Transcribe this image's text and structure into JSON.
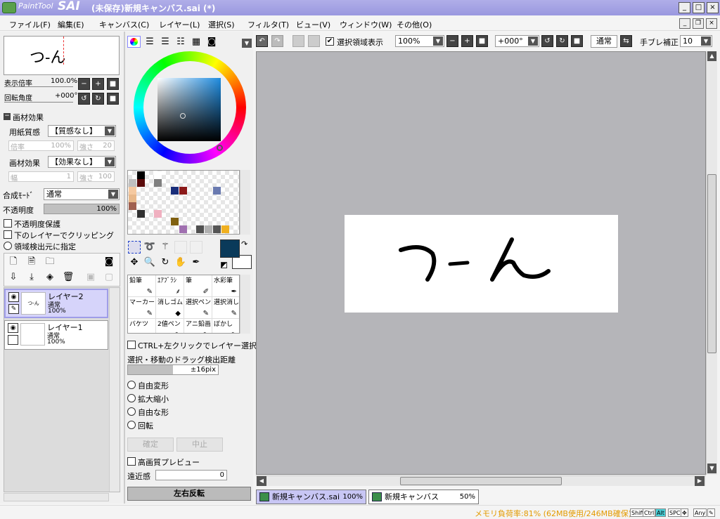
{
  "titlebar": {
    "logo_text": "PaintTool",
    "logo_brand": "SAI",
    "title": "(未保存)新規キャンバス.sai (*)",
    "minimize": "_",
    "maximize": "□",
    "close": "×"
  },
  "menu": [
    "ファイル(F)",
    "編集(E)",
    "キャンバス(C)",
    "レイヤー(L)",
    "選択(S)",
    "フィルタ(T)",
    "ビュー(V)",
    "ウィンドウ(W)",
    "その他(O)"
  ],
  "navigator": {
    "preview_text": "つ-ん",
    "zoom_label": "表示倍率",
    "zoom_value": "100.0%",
    "rotation_label": "回転角度",
    "rotation_value": "+000°"
  },
  "material": {
    "section_title": "画材効果",
    "paper_label": "用紙質感",
    "paper_value": "【質感なし】",
    "paper_scale_label": "倍率",
    "paper_scale_value": "100%",
    "paper_strength_label": "強さ",
    "paper_strength_value": "20",
    "effect_label": "画材効果",
    "effect_value": "【効果なし】",
    "effect_width_label": "幅",
    "effect_width_value": "1",
    "effect_strength_label": "強さ",
    "effect_strength_value": "100"
  },
  "layer_props": {
    "blend_label": "合成ﾓｰﾄﾞ",
    "blend_value": "通常",
    "opacity_label": "不透明度",
    "opacity_value": "100%",
    "opacity_fraction": 1.0,
    "preserve_opacity": "不透明度保護",
    "clip": "下のレイヤーでクリッピング",
    "selection_source": "領域検出元に指定"
  },
  "layers": [
    {
      "name": "レイヤー2",
      "mode": "通常",
      "opacity": "100%",
      "selected": true
    },
    {
      "name": "レイヤー1",
      "mode": "通常",
      "opacity": "100%",
      "selected": false
    }
  ],
  "palette": {
    "colors": [
      "#000000",
      "#ffffff",
      "#c0c0c0",
      "#5a0a0a",
      "#808080",
      "#f5c9a0",
      "#e8b88a",
      "#1a2e7a",
      "#8c1a1a",
      "#6a7ab0",
      "#a06050",
      "#303030",
      "#f0b0c0",
      "#806010",
      "#a070b0",
      "#505050",
      "#b0b0b0",
      "#555555",
      "#f0b020"
    ],
    "current_color": "#0a3a5a"
  },
  "brushes": [
    {
      "name": "鉛筆"
    },
    {
      "name": "ｴｱﾌﾞﾗｼ"
    },
    {
      "name": "筆"
    },
    {
      "name": "水彩筆"
    },
    {
      "name": "マーカー"
    },
    {
      "name": "消しゴム"
    },
    {
      "name": "選択ペン"
    },
    {
      "name": "選択消し"
    },
    {
      "name": "バケツ"
    },
    {
      "name": "2値ペン"
    },
    {
      "name": "アニ鉛画"
    },
    {
      "name": "ぼかし"
    }
  ],
  "tool_options": {
    "ctrl_select": "CTRL+左クリックでレイヤー選択",
    "drag_label": "選択・移動のドラッグ検出距離",
    "drag_value": "±16pix",
    "transforms": [
      "自由変形",
      "拡大縮小",
      "自由な形",
      "回転"
    ],
    "ok": "確定",
    "cancel": "中止",
    "hq_preview": "高画質プレビュー",
    "perspective_label": "遠近感",
    "perspective_value": "0",
    "flip": "左右反転"
  },
  "toolbar": {
    "show_selection": "選択領域表示",
    "zoom": "100%",
    "rotation": "+000°",
    "blend": "通常",
    "stabilizer_label": "手ブレ補正",
    "stabilizer_value": "10"
  },
  "canvas": {
    "text": "つ-ん"
  },
  "tabs": [
    {
      "name": "新規キャンバス.sai",
      "zoom": "100%"
    },
    {
      "name": "新規キャンバス",
      "zoom": "50%"
    }
  ],
  "status": {
    "memory": "メモリ負荷率:81% (62MB使用/246MB確保)",
    "keys": [
      "Shift",
      "Ctrl",
      "Alt",
      "SPC",
      "Any"
    ]
  }
}
